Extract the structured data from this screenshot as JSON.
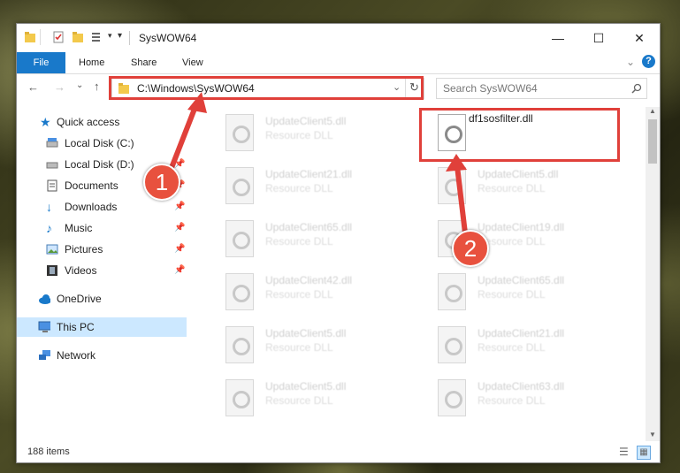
{
  "window": {
    "title": "SysWOW64",
    "ribbon_tabs": [
      "File",
      "Home",
      "Share",
      "View"
    ]
  },
  "address": {
    "path": "C:\\Windows\\SysWOW64"
  },
  "search": {
    "placeholder": "Search SysWOW64"
  },
  "nav": {
    "quick_access": "Quick access",
    "items": [
      {
        "label": "Local Disk (C:)",
        "icon": "drive-icon"
      },
      {
        "label": "Local Disk (D:)",
        "icon": "drive-icon"
      },
      {
        "label": "Documents",
        "icon": "documents-icon"
      },
      {
        "label": "Downloads",
        "icon": "downloads-icon"
      },
      {
        "label": "Music",
        "icon": "music-icon"
      },
      {
        "label": "Pictures",
        "icon": "pictures-icon"
      },
      {
        "label": "Videos",
        "icon": "videos-icon"
      }
    ],
    "onedrive": "OneDrive",
    "this_pc": "This PC",
    "network": "Network"
  },
  "files": [
    {
      "name": "UpdateClient5.dll",
      "type": "Resource DLL"
    },
    {
      "name": "df1sosfilter.dll",
      "type": ""
    },
    {
      "name": "UpdateClient21.dll",
      "type": "Resource DLL"
    },
    {
      "name": "UpdateClient5.dll",
      "type": "Resource DLL"
    },
    {
      "name": "UpdateClient65.dll",
      "type": "Resource DLL"
    },
    {
      "name": "UpdateClient19.dll",
      "type": "Resource DLL"
    },
    {
      "name": "UpdateClient42.dll",
      "type": "Resource DLL"
    },
    {
      "name": "UpdateClient65.dll",
      "type": "Resource DLL"
    },
    {
      "name": "UpdateClient5.dll",
      "type": "Resource DLL"
    },
    {
      "name": "UpdateClient21.dll",
      "type": "Resource DLL"
    },
    {
      "name": "UpdateClient5.dll",
      "type": "Resource DLL"
    },
    {
      "name": "UpdateClient63.dll",
      "type": "Resource DLL"
    }
  ],
  "status": {
    "item_count": "188 items"
  },
  "annotations": {
    "step1": "1",
    "step2": "2",
    "color": "#e0403a"
  }
}
